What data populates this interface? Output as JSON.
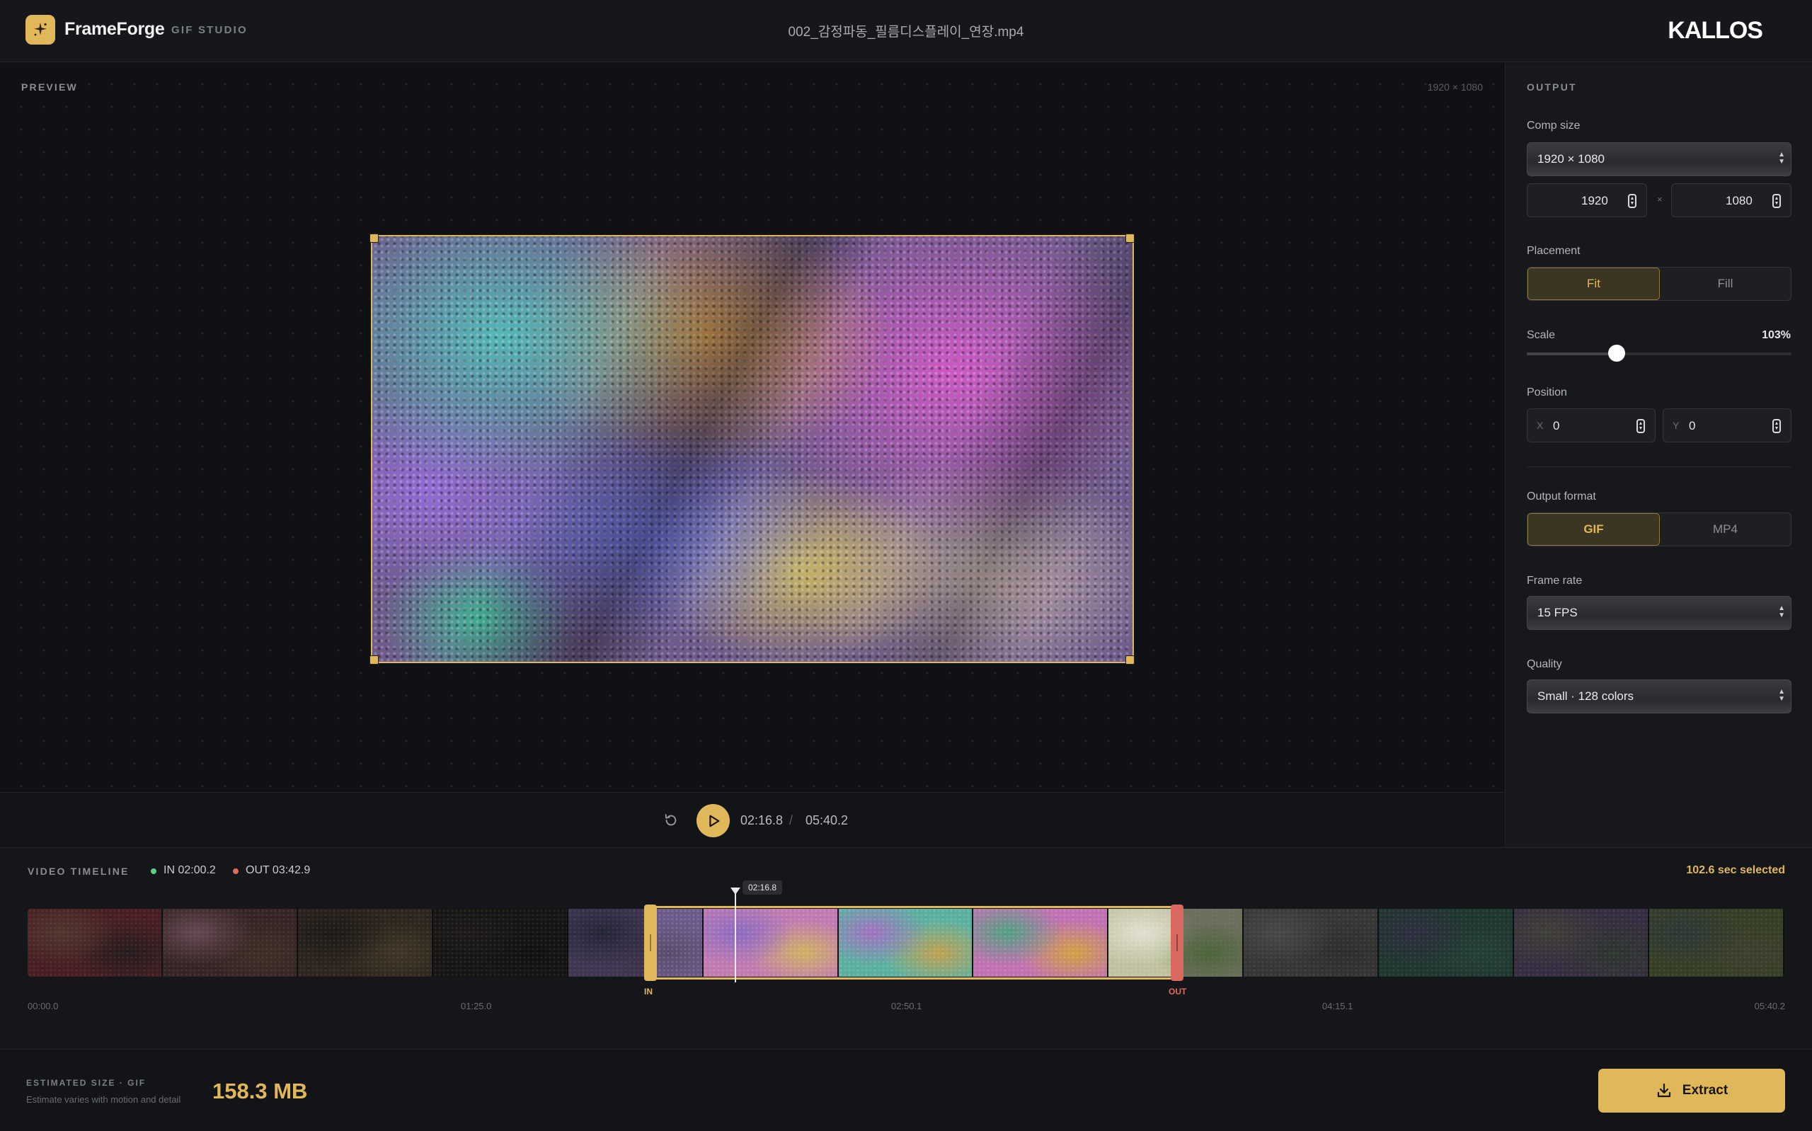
{
  "header": {
    "app_name": "FrameForge",
    "app_subtitle": "GIF STUDIO",
    "file_name": "002_감정파동_필름디스플레이_연장.mp4",
    "brand": "KALLOS"
  },
  "preview": {
    "label": "PREVIEW",
    "dimensions": "1920 × 1080"
  },
  "transport": {
    "current_time": "02:16.8",
    "separator": "/",
    "total_time": "05:40.2"
  },
  "output": {
    "label": "OUTPUT",
    "comp_size_label": "Comp size",
    "comp_size_value": "1920 × 1080",
    "width": "1920",
    "height": "1080",
    "times_sign": "×",
    "placement_label": "Placement",
    "placement_options": [
      "Fit",
      "Fill"
    ],
    "placement_selected": "Fit",
    "scale_label": "Scale",
    "scale_value": "103%",
    "scale_fraction": 0.34,
    "position_label": "Position",
    "position_x_letter": "X",
    "position_x": "0",
    "position_y_letter": "Y",
    "position_y": "0",
    "format_label": "Output format",
    "format_options": [
      "GIF",
      "MP4"
    ],
    "format_selected": "GIF",
    "frame_rate_label": "Frame rate",
    "frame_rate_value": "15 FPS",
    "quality_label": "Quality",
    "quality_value": "Small · 128 colors"
  },
  "timeline": {
    "label": "VIDEO TIMELINE",
    "in_text": "IN 02:00.2",
    "out_text": "OUT 03:42.9",
    "selected_text": "102.6 sec selected",
    "playhead_time": "02:16.8",
    "in_tag": "IN",
    "out_tag": "OUT",
    "ticks": [
      "00:00.0",
      "01:25.0",
      "02:50.1",
      "04:15.1",
      "05:40.2"
    ],
    "thumbnails": [
      {
        "name": "thumb-1",
        "colors": [
          "#7a2e33",
          "#8a5a4a",
          "#3a2a2c"
        ]
      },
      {
        "name": "thumb-2",
        "colors": [
          "#5a3a3a",
          "#b07a8a",
          "#6a4a3a"
        ]
      },
      {
        "name": "thumb-3",
        "colors": [
          "#4a3a2a",
          "#2a2520",
          "#6a5a3a"
        ]
      },
      {
        "name": "thumb-4",
        "colors": [
          "#201c1a",
          "#2a2622",
          "#1a1816"
        ]
      },
      {
        "name": "thumb-5",
        "colors": [
          "#6a5a8a",
          "#3a3a5a",
          "#5a4a6a"
        ]
      },
      {
        "name": "thumb-6",
        "colors": [
          "#c07ab0",
          "#8a6ac0",
          "#d0b060"
        ]
      },
      {
        "name": "thumb-7",
        "colors": [
          "#5ab0a0",
          "#a070c0",
          "#c0a050"
        ]
      },
      {
        "name": "thumb-8",
        "colors": [
          "#c070b0",
          "#50a080",
          "#d0a040"
        ]
      },
      {
        "name": "thumb-9",
        "colors": [
          "#c0c0a0",
          "#e0e0d0",
          "#80b060"
        ]
      },
      {
        "name": "thumb-10",
        "colors": [
          "#5a5a5a",
          "#7a7a78",
          "#4a4a48"
        ]
      },
      {
        "name": "thumb-11",
        "colors": [
          "#2e5a4a",
          "#4a4a6a",
          "#3a6a5a"
        ]
      },
      {
        "name": "thumb-12",
        "colors": [
          "#5a4a6a",
          "#6a6a5a",
          "#4a5a4a"
        ]
      },
      {
        "name": "thumb-13",
        "colors": [
          "#5a6a3a",
          "#4a5a5a",
          "#6a6a4a"
        ]
      }
    ]
  },
  "footer": {
    "estimate_label": "ESTIMATED SIZE · GIF",
    "estimate_note": "Estimate varies with motion and detail",
    "estimate_value": "158.3 MB",
    "extract_label": "Extract"
  },
  "colors": {
    "accent": "#e0b85a",
    "out_marker": "#d9685e",
    "in_marker": "#5fd08a"
  }
}
